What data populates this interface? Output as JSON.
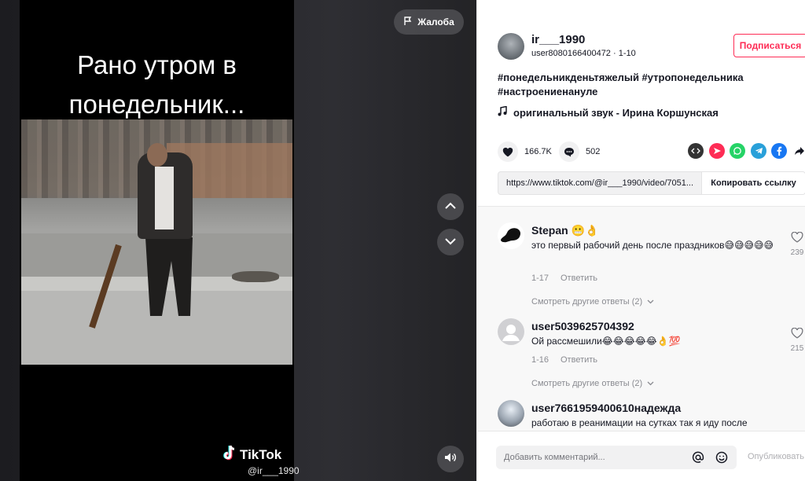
{
  "video": {
    "caption_line1": "Рано утром в",
    "caption_line2": "понедельник...",
    "logo_text": "TikTok",
    "handle": "@ir___1990",
    "report_label": "Жалоба",
    "icons": [
      "flag-icon",
      "chevron-up-icon",
      "chevron-down-icon",
      "volume-icon",
      "tiktok-logo-icon"
    ]
  },
  "author": {
    "username": "ir___1990",
    "meta": "user8080166400472 · 1-10",
    "follow_label": "Подписаться"
  },
  "description": {
    "hashtags_line1": "#понедельникденьтяжелый #утропонедельника",
    "hashtags_line2": "#настроениенануле"
  },
  "music": {
    "label": "оригинальный звук - Ирина Коршунская"
  },
  "stats": {
    "likes": "166.7K",
    "comments": "502"
  },
  "share": {
    "icons": [
      "embed-icon",
      "send-icon",
      "whatsapp-icon",
      "telegram-icon",
      "facebook-icon",
      "share-arrow-icon"
    ]
  },
  "link": {
    "url": "https://www.tiktok.com/@ir___1990/video/7051...",
    "copy_label": "Копировать ссылку"
  },
  "comments": [
    {
      "name": "Stepan 😬👌",
      "text": "это первый рабочий день после праздников😅😅😅😅😅",
      "date": "1-17",
      "reply_label": "Ответить",
      "likes": "239",
      "more_label": "Смотреть другие ответы (2)"
    },
    {
      "name": "user5039625704392",
      "text": "Ой рассмешили😂😂😂😂😂👌💯",
      "date": "1-16",
      "reply_label": "Ответить",
      "likes": "215",
      "more_label": "Смотреть другие ответы (2)"
    },
    {
      "name": "user7661959400610надежда",
      "text": "работаю в реанимации на сутках так я иду после"
    }
  ],
  "comment_bar": {
    "placeholder": "Добавить комментарий...",
    "post_label": "Опубликовать"
  },
  "colors": {
    "accent": "#fe2c55",
    "text": "#161823",
    "muted": "#8a8b91"
  }
}
